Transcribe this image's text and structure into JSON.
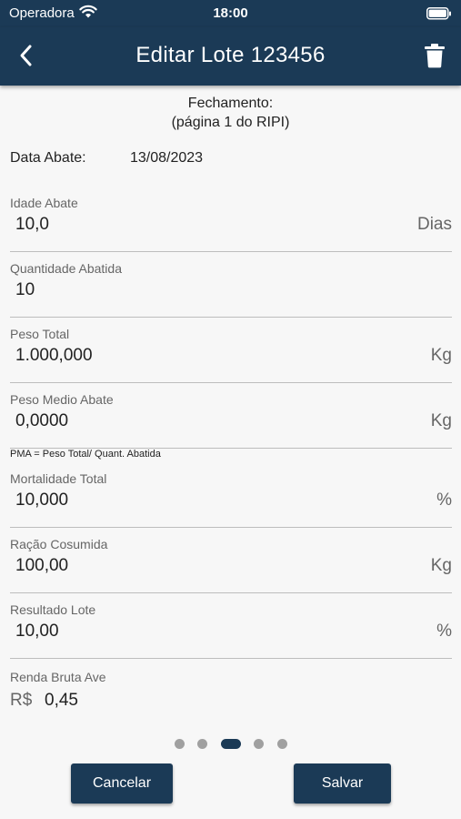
{
  "status_bar": {
    "carrier": "Operadora",
    "time": "18:00"
  },
  "nav": {
    "title": "Editar Lote 123456"
  },
  "section": {
    "title_line1": "Fechamento:",
    "title_line2": "(página 1 do RIPI)"
  },
  "date": {
    "label": "Data Abate:",
    "value": "13/08/2023"
  },
  "fields": [
    {
      "label": "Idade Abate",
      "value": "10,0",
      "unit": "Dias"
    },
    {
      "label": "Quantidade Abatida",
      "value": "10",
      "unit": ""
    },
    {
      "label": "Peso Total",
      "value": "1.000,000",
      "unit": "Kg"
    },
    {
      "label": "Peso Medio Abate",
      "value": "0,0000",
      "unit": "Kg"
    },
    {
      "label": "Mortalidade Total",
      "value": "10,000",
      "unit": "%"
    },
    {
      "label": "Ração Cosumida",
      "value": "100,00",
      "unit": "Kg"
    },
    {
      "label": "Resultado Lote",
      "value": "10,00",
      "unit": "%"
    }
  ],
  "note": "PMA = Peso Total/ Quant. Abatida",
  "renda": {
    "label": "Renda Bruta Ave",
    "currency": "R$",
    "value": "0,45"
  },
  "pager": {
    "pages": 5,
    "active_index": 2
  },
  "buttons": {
    "cancel": "Cancelar",
    "save": "Salvar"
  },
  "colors": {
    "primary": "#1b3a56",
    "background": "#f7f7f7",
    "divider": "#bdbdbd"
  },
  "icons": {
    "back": "chevron-left-icon",
    "delete": "trash-icon",
    "wifi": "wifi-icon",
    "battery": "battery-icon"
  }
}
